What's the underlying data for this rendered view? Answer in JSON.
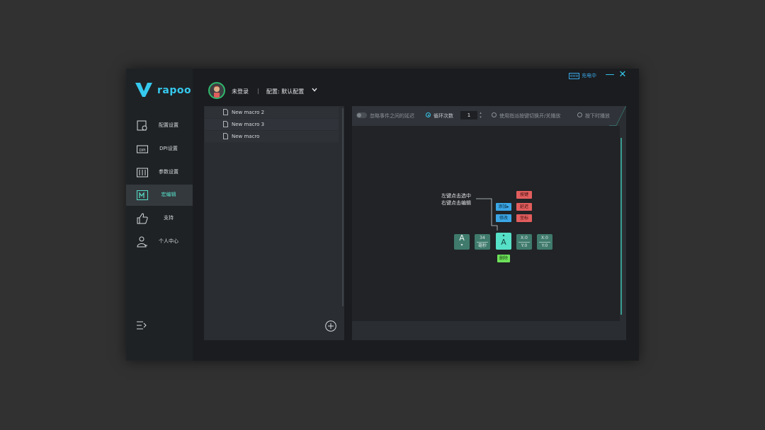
{
  "app": {
    "brand": "rapoo"
  },
  "titlebar": {
    "charge_icon_text": "WWW",
    "charge_status": "充电中",
    "minimize_glyph": "—",
    "close_glyph": "✕"
  },
  "header": {
    "user_name": "未登录",
    "separator": "|",
    "config_label": "配置: 默认配置"
  },
  "sidebar": {
    "items": [
      {
        "label": "配置设置",
        "icon": "config-icon",
        "active": false
      },
      {
        "label": "DPI设置",
        "icon": "dpi-icon",
        "active": false
      },
      {
        "label": "参数设置",
        "icon": "params-icon",
        "active": false
      },
      {
        "label": "宏编辑",
        "icon": "macro-icon",
        "active": true
      },
      {
        "label": "支持",
        "icon": "thumbs-up-icon",
        "active": false
      },
      {
        "label": "个人中心",
        "icon": "user-icon",
        "active": false
      }
    ]
  },
  "macros": {
    "list": [
      {
        "name": "New macro 2"
      },
      {
        "name": "New macro 3"
      },
      {
        "name": "New macro"
      }
    ]
  },
  "toolbar": {
    "ignore_delay_label": "忽略事件之间的延迟",
    "loop_label": "循环次数",
    "loop_value": "1",
    "toggle_mode_label": "使用指派按键切换开/关播放",
    "hold_mode_label": "按下时播放"
  },
  "editor": {
    "hint_line1": "左键点击选中",
    "hint_line2": "右键点击编辑",
    "add_label": "添加",
    "add_arrow": "▸",
    "edit_label": "修改",
    "key_tag": "按键",
    "delay_tag": "延迟",
    "coord_tag": "坐标",
    "delete_tag": "删除",
    "events": [
      {
        "top": "A",
        "bottom": "▾"
      },
      {
        "top": "34",
        "bottom": "毫秒"
      },
      {
        "top": "▴",
        "bottom": "A"
      },
      {
        "top": "X:0",
        "bottom": "Y:0"
      },
      {
        "top": "X:0",
        "bottom": "Y:0"
      }
    ]
  },
  "colors": {
    "accent": "#35c9ee",
    "active_node": "#56e0c8",
    "delete": "#6ee35a",
    "warn": "#e25d5d"
  }
}
